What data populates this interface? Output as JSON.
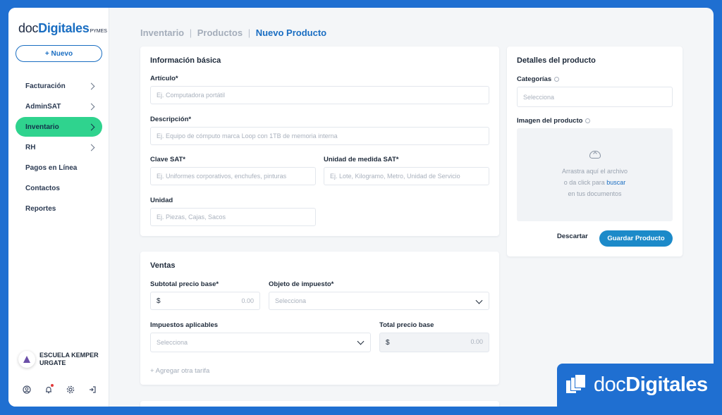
{
  "app": {
    "logo_doc": "doc",
    "logo_digitales": "Digitales",
    "logo_pymes": "PYMES",
    "new_button": "+ Nuevo"
  },
  "sidebar": {
    "items": [
      {
        "label": "Facturación",
        "has_chevron": true,
        "active": false
      },
      {
        "label": "AdminSAT",
        "has_chevron": true,
        "active": false
      },
      {
        "label": "Inventario",
        "has_chevron": true,
        "active": true
      },
      {
        "label": "RH",
        "has_chevron": true,
        "active": false
      },
      {
        "label": "Pagos en Línea",
        "has_chevron": false,
        "active": false
      },
      {
        "label": "Contactos",
        "has_chevron": false,
        "active": false
      },
      {
        "label": "Reportes",
        "has_chevron": false,
        "active": false
      }
    ],
    "organization": "ESCUELA KEMPER URGATE",
    "bottom_icons": [
      "user-icon",
      "bell-icon",
      "gear-icon",
      "logout-icon"
    ]
  },
  "breadcrumb": {
    "part1": "Inventario",
    "part2": "Productos",
    "current": "Nuevo Producto",
    "separator": "|"
  },
  "basic_info": {
    "title": "Información básica",
    "articulo_label": "Artículo*",
    "articulo_placeholder": "Ej. Computadora portátil",
    "descripcion_label": "Descripción*",
    "descripcion_placeholder": "Ej. Equipo de cómputo marca Loop con 1TB de memoria interna",
    "clave_label": "Clave SAT*",
    "clave_placeholder": "Ej. Uniformes corporativos, enchufes, pinturas",
    "unidad_sat_label": "Unidad de medida SAT*",
    "unidad_sat_placeholder": "Ej. Lote, Kilogramo, Metro, Unidad de Servicio",
    "unidad_label": "Unidad",
    "unidad_placeholder": "Ej. Piezas, Cajas, Sacos"
  },
  "sales": {
    "title": "Ventas",
    "subtotal_label": "Subtotal precio base*",
    "subtotal_prefix": "$",
    "subtotal_value": "0.00",
    "objeto_label": "Objeto de impuesto*",
    "objeto_placeholder": "Selecciona",
    "impuestos_label": "Impuestos aplicables",
    "impuestos_placeholder": "Selecciona",
    "total_label": "Total precio base",
    "total_prefix": "$",
    "total_value": "0.00",
    "add_tariff": "+ Agregar otra tarifa"
  },
  "details": {
    "title": "Detalles del producto",
    "categorias_label": "Categorías",
    "categorias_placeholder": "Selecciona",
    "imagen_label": "Imagen del producto",
    "dropzone_line1": "Arrastra aquí el archivo",
    "dropzone_line2a": "o da click para",
    "dropzone_link": "buscar",
    "dropzone_line3": "en tus documentos",
    "discard_button": "Descartar",
    "save_button": "Guardar Producto"
  },
  "badge": {
    "doc": "doc",
    "digitales": "Digitales"
  },
  "colors": {
    "brand_blue": "#1f6fd1",
    "accent_green": "#2fd38e",
    "primary_button": "#1c8ac9",
    "link_blue": "#1a6ec2"
  }
}
